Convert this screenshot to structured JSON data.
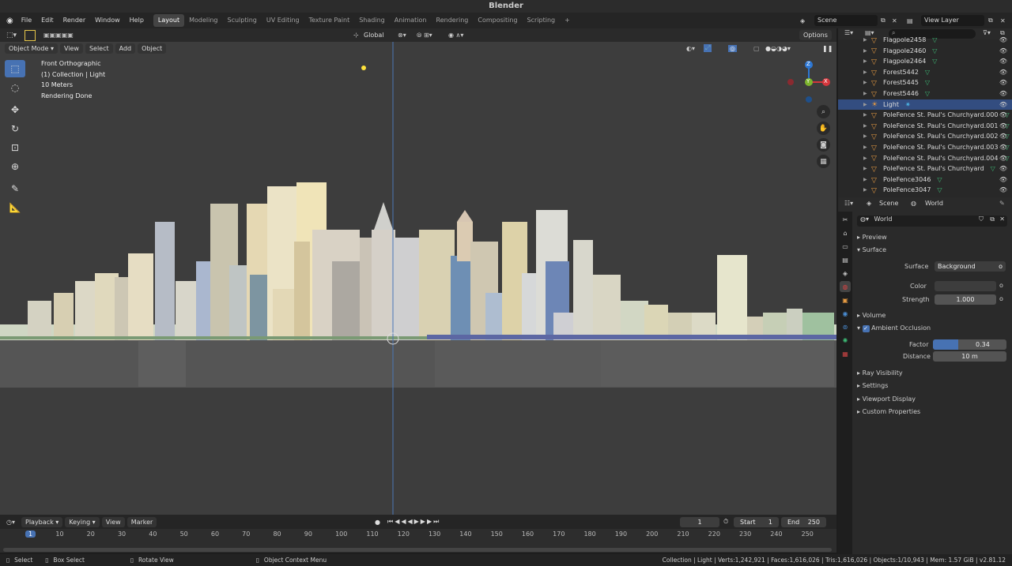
{
  "app": {
    "title": "Blender"
  },
  "menu": [
    "File",
    "Edit",
    "Render",
    "Window",
    "Help"
  ],
  "workspaces": [
    "Layout",
    "Modeling",
    "Sculpting",
    "UV Editing",
    "Texture Paint",
    "Shading",
    "Animation",
    "Rendering",
    "Compositing",
    "Scripting"
  ],
  "active_workspace": "Layout",
  "top_right": {
    "scene": "Scene",
    "view_layer": "View Layer"
  },
  "viewport_header": {
    "orientation": "Global",
    "options": "Options"
  },
  "viewport_header2": {
    "mode": "Object Mode",
    "view": "View",
    "select": "Select",
    "add": "Add",
    "object": "Object"
  },
  "overlay": {
    "line1": "Front Orthographic",
    "line2": "(1) Collection | Light",
    "line3": "10 Meters",
    "line4": "Rendering Done"
  },
  "gizmo": {
    "z": "Z",
    "y": "Y",
    "x": "X"
  },
  "outliner": {
    "items": [
      {
        "name": "Flagpole2458",
        "icon": "mesh-icon",
        "selected": false
      },
      {
        "name": "Flagpole2460",
        "icon": "mesh-icon",
        "selected": false
      },
      {
        "name": "Flagpole2464",
        "icon": "mesh-icon",
        "selected": false
      },
      {
        "name": "Forest5442",
        "icon": "mesh-icon",
        "selected": false
      },
      {
        "name": "Forest5445",
        "icon": "mesh-icon",
        "selected": false
      },
      {
        "name": "Forest5446",
        "icon": "mesh-icon",
        "selected": false
      },
      {
        "name": "Light",
        "icon": "light-icon",
        "selected": true
      },
      {
        "name": "PoleFence St. Paul's Churchyard.000",
        "icon": "mesh-icon",
        "selected": false
      },
      {
        "name": "PoleFence St. Paul's Churchyard.001",
        "icon": "mesh-icon",
        "selected": false
      },
      {
        "name": "PoleFence St. Paul's Churchyard.002",
        "icon": "mesh-icon",
        "selected": false
      },
      {
        "name": "PoleFence St. Paul's Churchyard.003",
        "icon": "mesh-icon",
        "selected": false
      },
      {
        "name": "PoleFence St. Paul's Churchyard.004",
        "icon": "mesh-icon",
        "selected": false
      },
      {
        "name": "PoleFence St. Paul's Churchyard",
        "icon": "mesh-icon",
        "selected": false
      },
      {
        "name": "PoleFence3046",
        "icon": "mesh-icon",
        "selected": false
      },
      {
        "name": "PoleFence3047",
        "icon": "mesh-icon",
        "selected": false
      }
    ]
  },
  "properties": {
    "breadcrumb_scene": "Scene",
    "breadcrumb_world": "World",
    "world_name": "World",
    "preview": "Preview",
    "surface": "Surface",
    "surface_label": "Surface",
    "surface_value": "Background",
    "color_label": "Color",
    "strength_label": "Strength",
    "strength_value": "1.000",
    "volume": "Volume",
    "ao": "Ambient Occlusion",
    "factor_label": "Factor",
    "factor_value": "0.34",
    "factor_fraction": 0.34,
    "distance_label": "Distance",
    "distance_value": "10 m",
    "ray_visibility": "Ray Visibility",
    "settings": "Settings",
    "viewport_display": "Viewport Display",
    "custom_props": "Custom Properties"
  },
  "timeline": {
    "playback": "Playback",
    "keying": "Keying",
    "view": "View",
    "marker": "Marker",
    "current_frame": "1",
    "start_label": "Start",
    "start": "1",
    "end_label": "End",
    "end": "250",
    "ticks": [
      "1",
      "10",
      "20",
      "30",
      "40",
      "50",
      "60",
      "70",
      "80",
      "90",
      "100",
      "110",
      "120",
      "130",
      "140",
      "150",
      "160",
      "170",
      "180",
      "190",
      "200",
      "210",
      "220",
      "230",
      "240",
      "250"
    ]
  },
  "statusbar": {
    "select": "Select",
    "box_select": "Box Select",
    "rotate_view": "Rotate View",
    "context_menu": "Object Context Menu",
    "stats": "Collection | Light | Verts:1,242,921 | Faces:1,616,026 | Tris:1,616,026 | Objects:1/10,943 | Mem: 1.57 GiB | v2.81.12"
  },
  "colors": {
    "accent": "#4772b3",
    "selected_row": "#334d80",
    "mesh_icon": "#e59a42",
    "vis_icon": "#3dba75"
  }
}
